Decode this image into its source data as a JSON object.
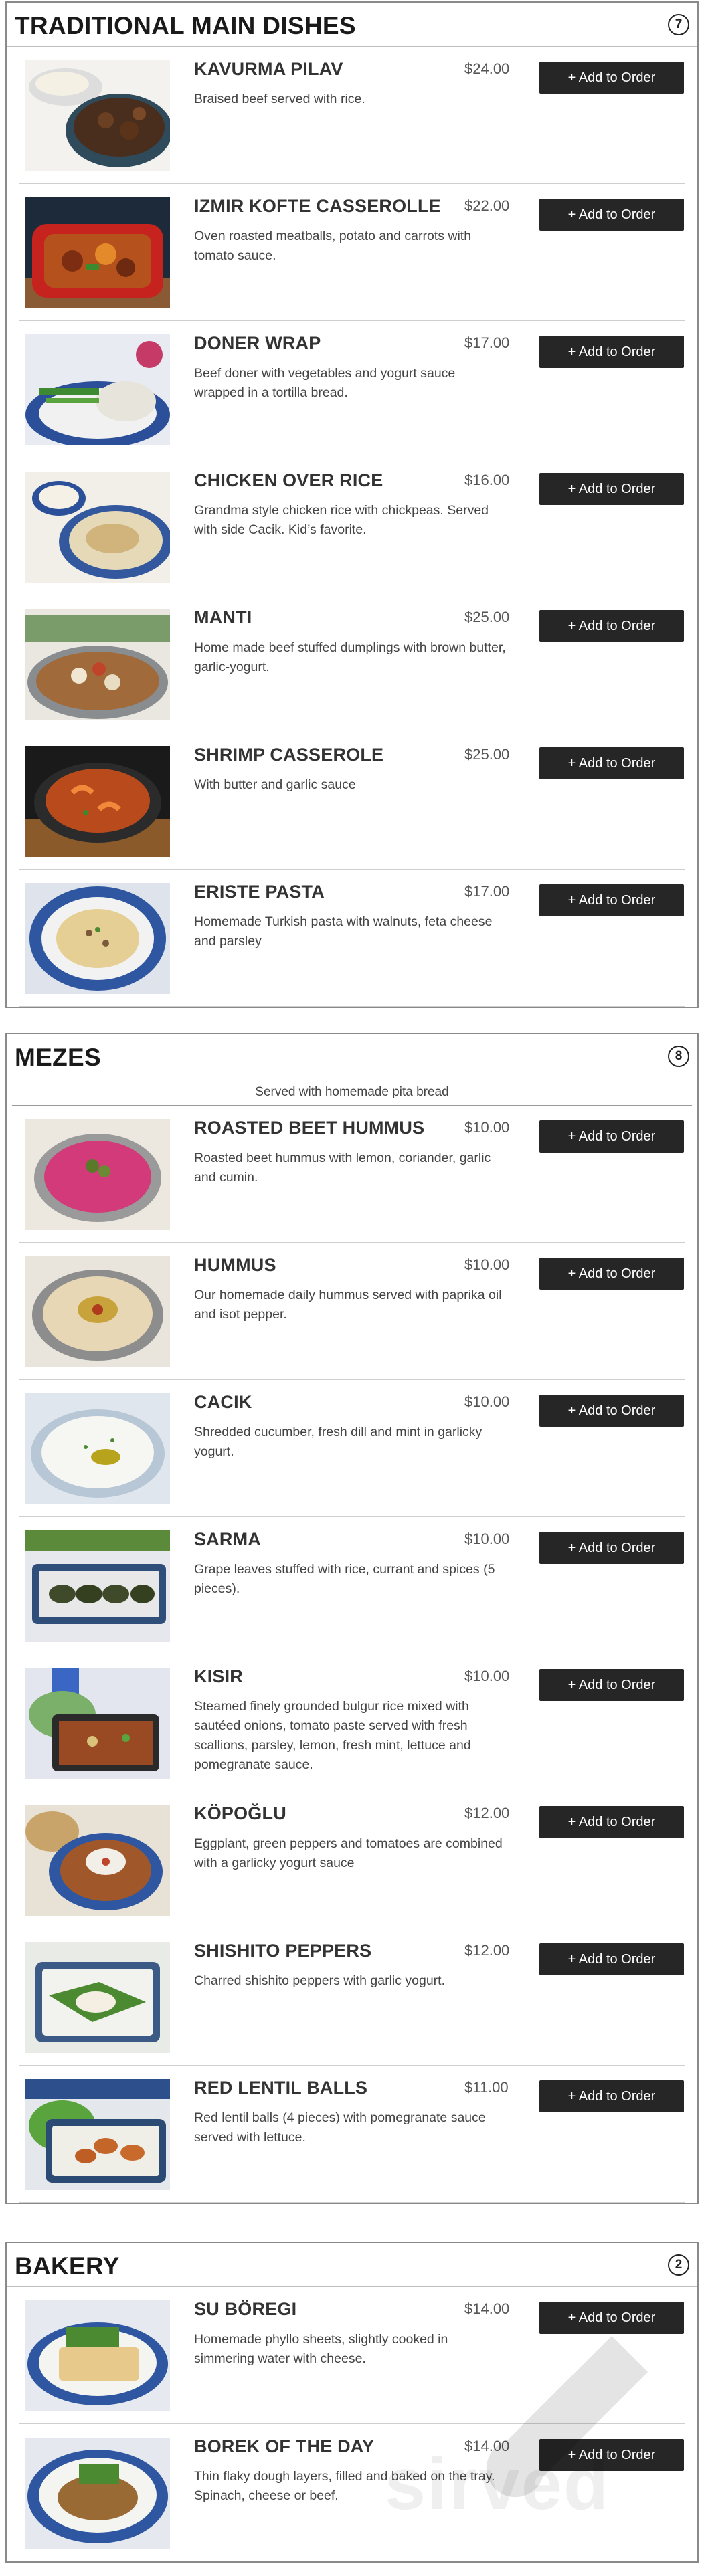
{
  "sections": [
    {
      "title": "TRADITIONAL MAIN DISHES",
      "count": "7",
      "note": "",
      "items": [
        {
          "name": "KAVURMA PILAV",
          "price": "$24.00",
          "desc": "Braised beef served with rice.",
          "button": "+ Add to Order"
        },
        {
          "name": "IZMIR KOFTE CASSEROLLE",
          "price": "$22.00",
          "desc": "Oven roasted meatballs, potato and carrots with tomato sauce.",
          "button": "+ Add to Order"
        },
        {
          "name": "DONER WRAP",
          "price": "$17.00",
          "desc": "Beef doner with vegetables and yogurt sauce wrapped in a tortilla bread.",
          "button": "+ Add to Order"
        },
        {
          "name": "CHICKEN OVER RICE",
          "price": "$16.00",
          "desc": "Grandma style chicken rice with chickpeas. Served with side Cacik. Kid’s favorite.",
          "button": "+ Add to Order"
        },
        {
          "name": "MANTI",
          "price": "$25.00",
          "desc": "Home made beef stuffed dumplings with brown butter, garlic-yogurt.",
          "button": "+ Add to Order"
        },
        {
          "name": "SHRIMP CASSEROLE",
          "price": "$25.00",
          "desc": "With butter and garlic sauce",
          "button": "+ Add to Order"
        },
        {
          "name": "ERISTE PASTA",
          "price": "$17.00",
          "desc": "Homemade Turkish pasta with walnuts, feta cheese and parsley",
          "button": "+ Add to Order"
        }
      ]
    },
    {
      "title": "MEZES",
      "count": "8",
      "note": "Served with homemade pita bread",
      "items": [
        {
          "name": "ROASTED BEET HUMMUS",
          "price": "$10.00",
          "desc": "Roasted beet hummus with lemon, coriander, garlic and cumin.",
          "button": "+ Add to Order"
        },
        {
          "name": "HUMMUS",
          "price": "$10.00",
          "desc": "Our homemade daily hummus served with paprika oil and isot pepper.",
          "button": "+ Add to Order"
        },
        {
          "name": "CACIK",
          "price": "$10.00",
          "desc": "Shredded cucumber, fresh dill and mint in garlicky yogurt.",
          "button": "+ Add to Order"
        },
        {
          "name": "SARMA",
          "price": "$10.00",
          "desc": "Grape leaves stuffed with rice, currant and spices (5 pieces).",
          "button": "+ Add to Order"
        },
        {
          "name": "KISIR",
          "price": "$10.00",
          "desc": "Steamed finely grounded bulgur rice mixed with sautéed onions, tomato paste served with fresh scallions, parsley, lemon, fresh mint, lettuce and pomegranate sauce.",
          "button": "+ Add to Order"
        },
        {
          "name": "KÖPOĞLU",
          "price": "$12.00",
          "desc": "Eggplant, green peppers and tomatoes are combined with a garlicky yogurt sauce",
          "button": "+ Add to Order"
        },
        {
          "name": "SHISHITO PEPPERS",
          "price": "$12.00",
          "desc": "Charred shishito peppers with garlic yogurt.",
          "button": "+ Add to Order"
        },
        {
          "name": "RED LENTIL BALLS",
          "price": "$11.00",
          "desc": "Red lentil balls (4 pieces) with pomegranate sauce served with lettuce.",
          "button": "+ Add to Order"
        }
      ]
    },
    {
      "title": "BAKERY",
      "count": "2",
      "note": "",
      "items": [
        {
          "name": "SU BÖREGI",
          "price": "$14.00",
          "desc": "Homemade phyllo sheets, slightly cooked in simmering water with cheese.",
          "button": "+ Add to Order"
        },
        {
          "name": "BOREK OF THE DAY",
          "price": "$14.00",
          "desc": "Thin flaky dough layers, filled and baked on the tray. Spinach, cheese or beef.",
          "button": "+ Add to Order"
        }
      ]
    }
  ],
  "watermark": "sirved",
  "colors": {
    "button_bg": "#262626",
    "border": "#8a8a8a"
  }
}
